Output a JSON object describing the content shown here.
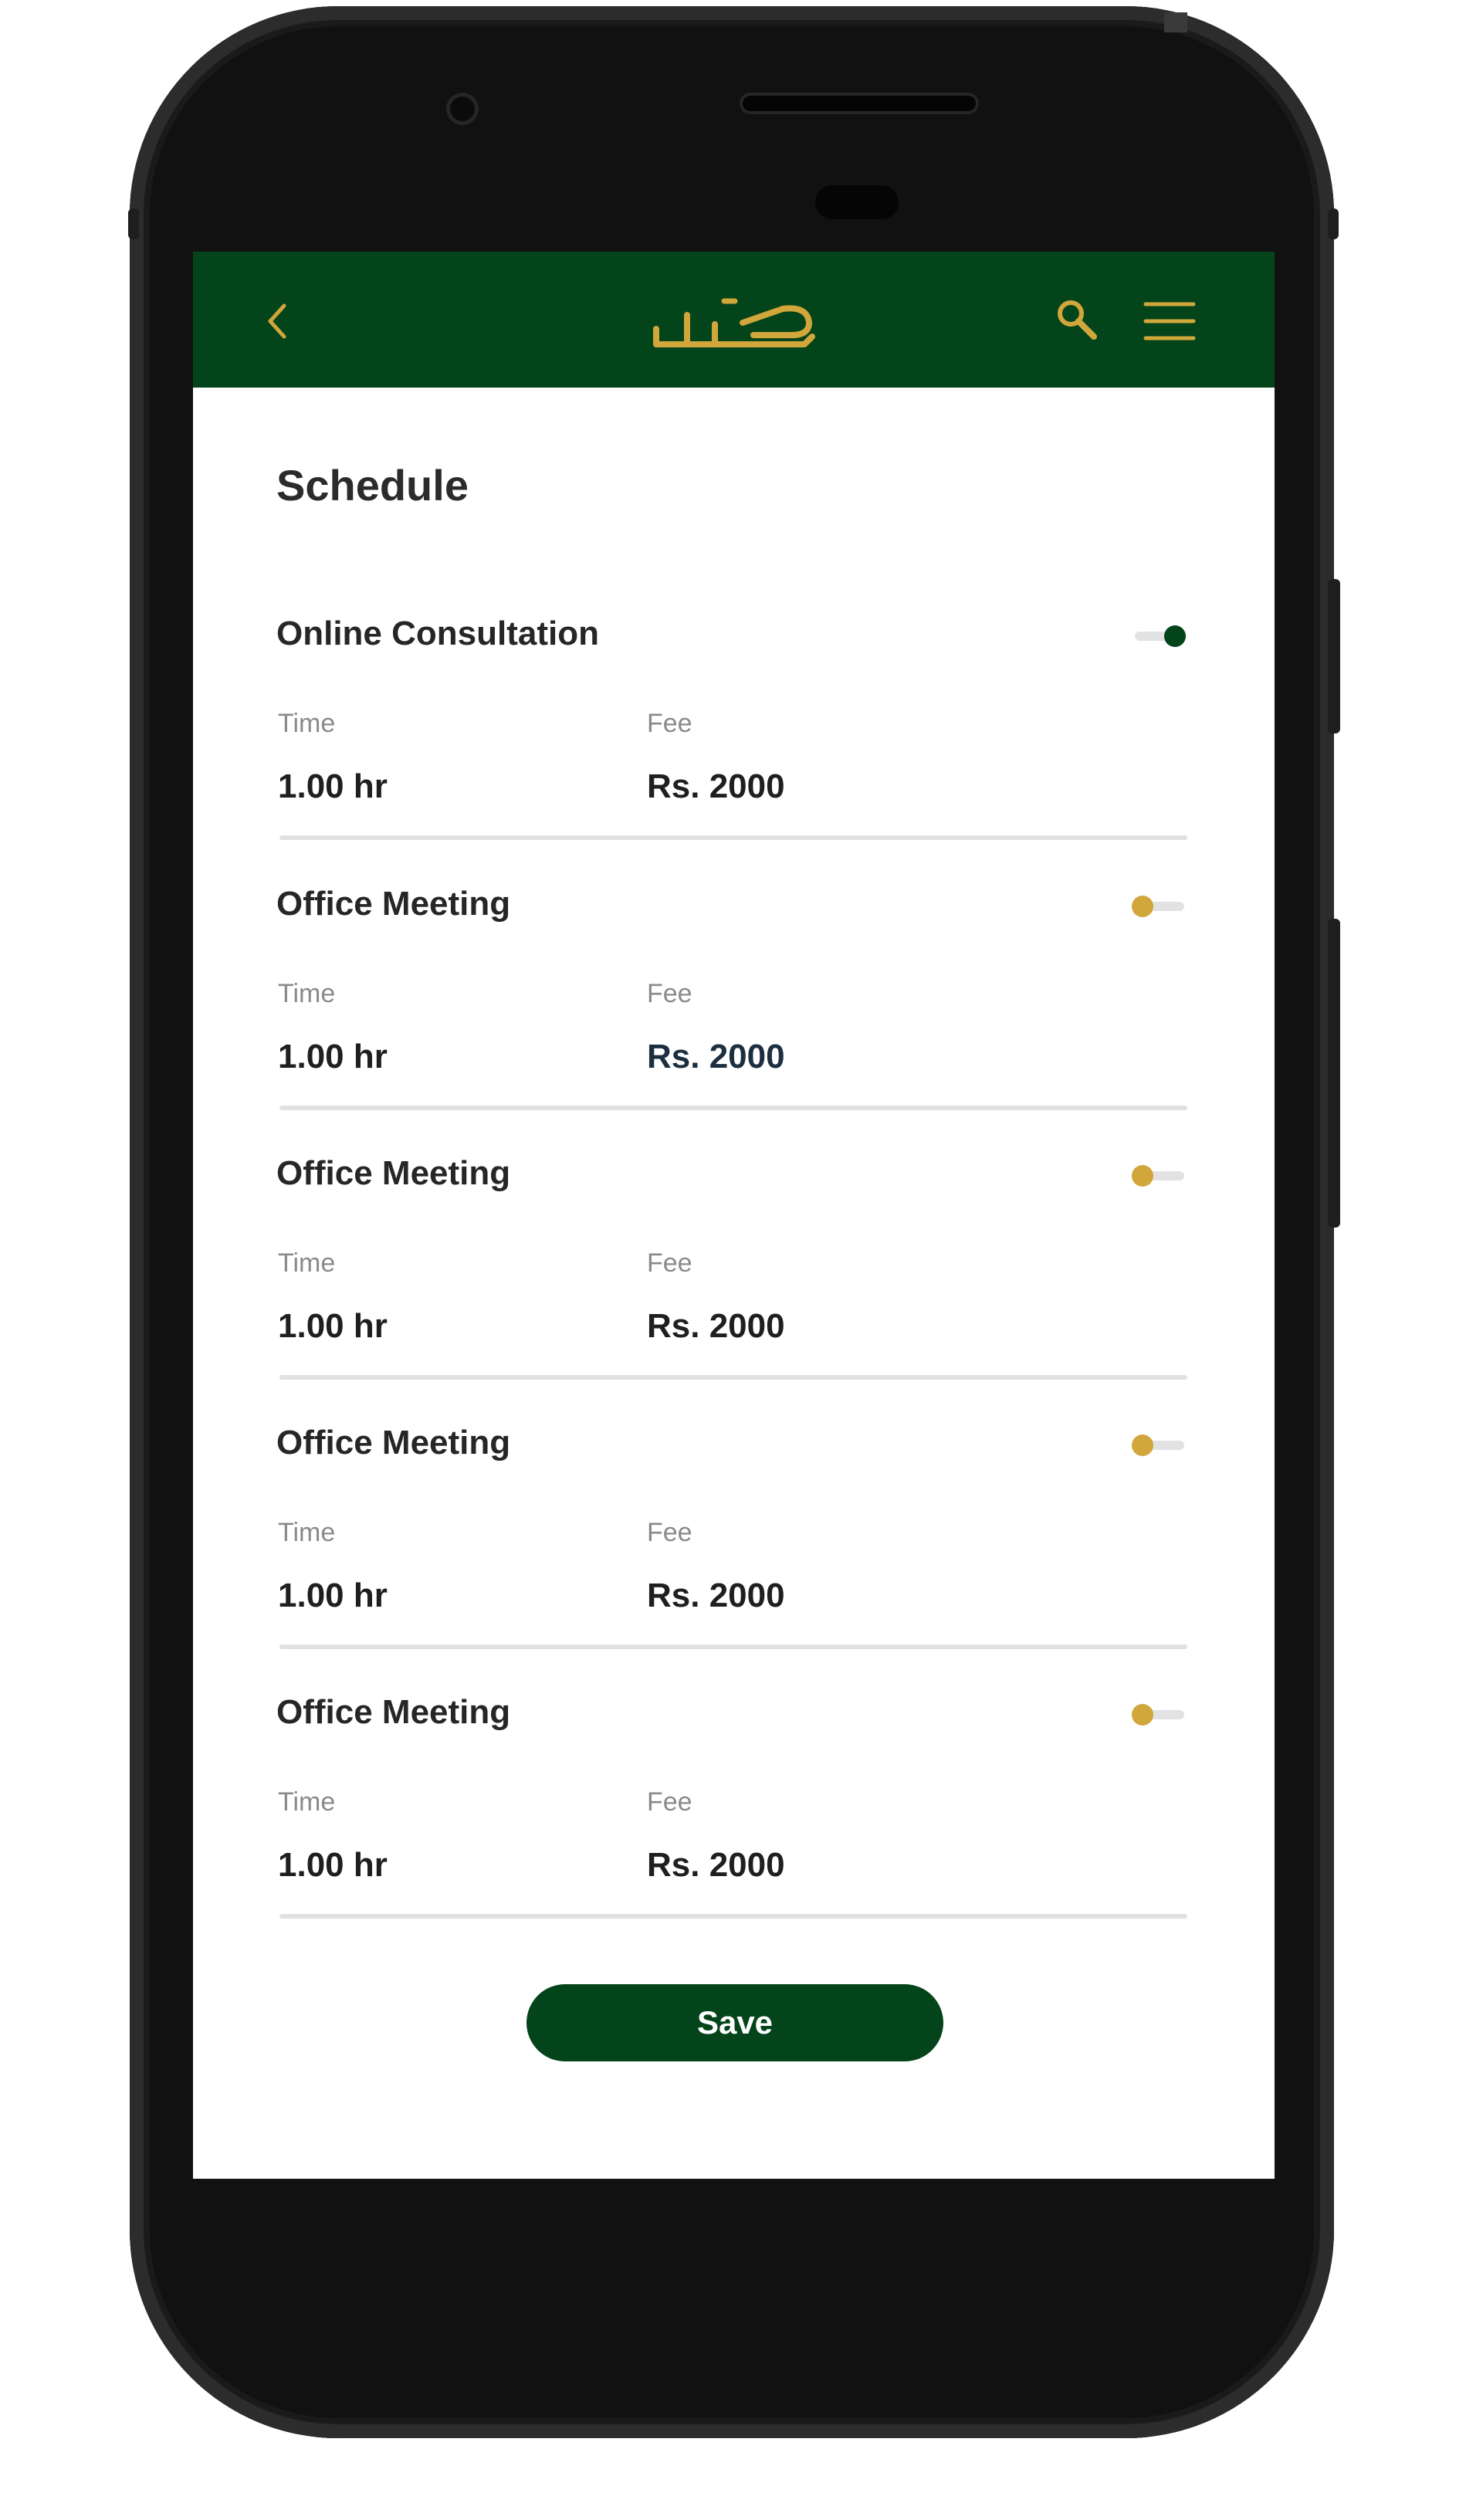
{
  "colors": {
    "brand_green": "#04441a",
    "accent_gold": "#d1a63a",
    "phone_body": "#111111"
  },
  "header": {
    "back_icon": "chevron-left-icon",
    "logo": "app-logo",
    "search_icon": "search-icon",
    "menu_icon": "hamburger-menu-icon"
  },
  "page": {
    "title": "Schedule"
  },
  "schedule": [
    {
      "name": "Online Consultation",
      "enabled": true,
      "time_label": "Time",
      "time_value": "1.00 hr",
      "fee_label": "Fee",
      "fee_value": "Rs. 2000"
    },
    {
      "name": "Office Meeting",
      "enabled": false,
      "time_label": "Time",
      "time_value": "1.00 hr",
      "fee_label": "Fee",
      "fee_value": "Rs. 2000"
    },
    {
      "name": "Office Meeting",
      "enabled": false,
      "time_label": "Time",
      "time_value": "1.00 hr",
      "fee_label": "Fee",
      "fee_value": "Rs. 2000"
    },
    {
      "name": "Office Meeting",
      "enabled": false,
      "time_label": "Time",
      "time_value": "1.00 hr",
      "fee_label": "Fee",
      "fee_value": "Rs. 2000"
    },
    {
      "name": "Office Meeting",
      "enabled": false,
      "time_label": "Time",
      "time_value": "1.00 hr",
      "fee_label": "Fee",
      "fee_value": "Rs. 2000"
    }
  ],
  "actions": {
    "save_label": "Save"
  }
}
